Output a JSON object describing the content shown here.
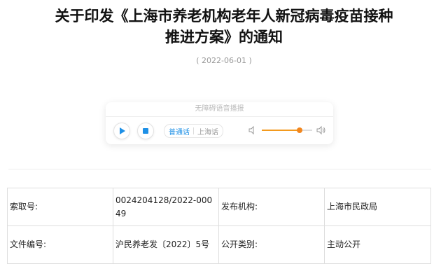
{
  "article": {
    "title_line1": "关于印发《上海市养老机构老年人新冠病毒疫苗接种",
    "title_line2": "推进方案》的通知",
    "date": "( 2022-06-01 )"
  },
  "player": {
    "header": "无障碍语音播报",
    "play_icon": "play-icon",
    "stop_icon": "stop-icon",
    "lang_active": "普通话",
    "lang_other": "上海话",
    "volume": 0.75,
    "accent_color": "#1e90e6",
    "slider_color": "#f39a1e"
  },
  "meta": {
    "rows": [
      {
        "label1": "索取号:",
        "value1": "0024204128/2022-00049",
        "label2": "发布机构:",
        "value2": "上海市民政局"
      },
      {
        "label1": "文件编号:",
        "value1": "沪民养老发〔2022〕5号",
        "label2": "公开类别:",
        "value2": "主动公开"
      }
    ]
  }
}
